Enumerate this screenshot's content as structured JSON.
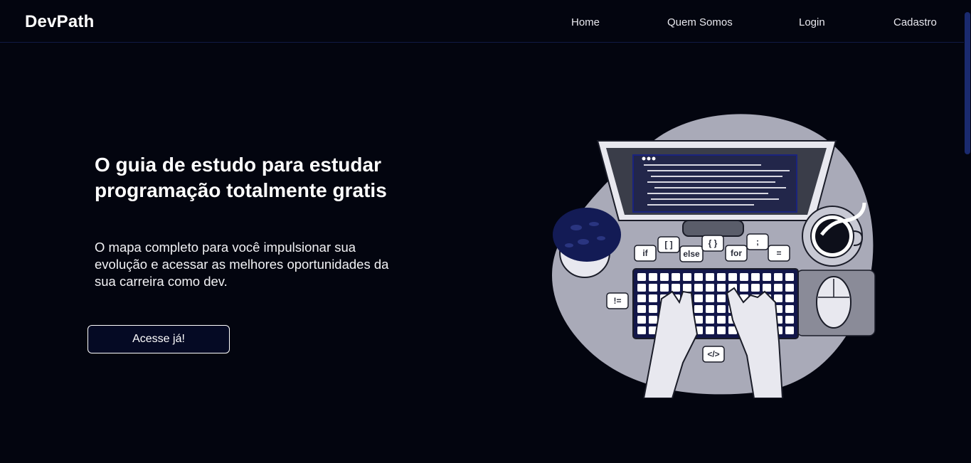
{
  "header": {
    "logo": "DevPath",
    "nav": [
      {
        "label": "Home"
      },
      {
        "label": "Quem Somos"
      },
      {
        "label": "Login"
      },
      {
        "label": "Cadastro"
      }
    ]
  },
  "hero": {
    "title": "O guia de estudo para estudar programação totalmente gratis",
    "description": "O mapa completo para você impulsionar sua evolução e acessar as melhores oportunidades da sua carreira como dev.",
    "cta_label": "Acesse já!"
  },
  "illustration": {
    "code_bubbles": [
      "if",
      "[ ]",
      "else",
      "{ }",
      "for",
      ";",
      "=",
      "!=",
      "</>"
    ]
  },
  "colors": {
    "background": "#03050f",
    "header_border": "#101a44",
    "button_bg": "#050a24",
    "illustration_bg": "#a9aab8",
    "scroll_thumb": "#1a2a6e"
  }
}
